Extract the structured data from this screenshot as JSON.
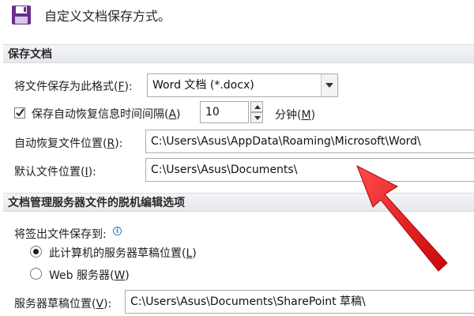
{
  "header": {
    "icon": "floppy-disk-icon",
    "title": "自定义文档保存方式。"
  },
  "section_save": {
    "title": "保存文档",
    "format_label": "将文件保存为此格式(",
    "format_key": "F",
    "format_label_end": "):",
    "format_value": "Word 文档 (*.docx)",
    "autorecover_checked": true,
    "autorecover_label": "保存自动恢复信息时间间隔(",
    "autorecover_key": "A",
    "autorecover_label_end": ")",
    "autorecover_value": "10",
    "minutes_label": "分钟(",
    "minutes_key": "M",
    "minutes_label_end": ")",
    "autorecover_path_label": "自动恢复文件位置(",
    "autorecover_path_key": "R",
    "autorecover_path_label_end": "):",
    "autorecover_path_value": "C:\\Users\\Asus\\AppData\\Roaming\\Microsoft\\Word\\",
    "default_path_label": "默认文件位置(",
    "default_path_key": "I",
    "default_path_label_end": "):",
    "default_path_value": "C:\\Users\\Asus\\Documents\\"
  },
  "section_offline": {
    "title": "文档管理服务器文件的脱机编辑选项",
    "checkout_label": "将签出文件保存到:",
    "option_local_label": "此计算机的服务器草稿位置(",
    "option_local_key": "L",
    "option_local_label_end": ")",
    "option_local_selected": true,
    "option_web_label": "Web 服务器(",
    "option_web_key": "W",
    "option_web_label_end": ")",
    "option_web_selected": false,
    "drafts_label": "服务器草稿位置(",
    "drafts_key": "V",
    "drafts_label_end": "):",
    "drafts_value": "C:\\Users\\Asus\\Documents\\SharePoint 草稿\\"
  },
  "colors": {
    "annotation_arrow": "#e3191c",
    "section_bg": "#e9ebee",
    "icon_purple": "#6c2c8e"
  }
}
